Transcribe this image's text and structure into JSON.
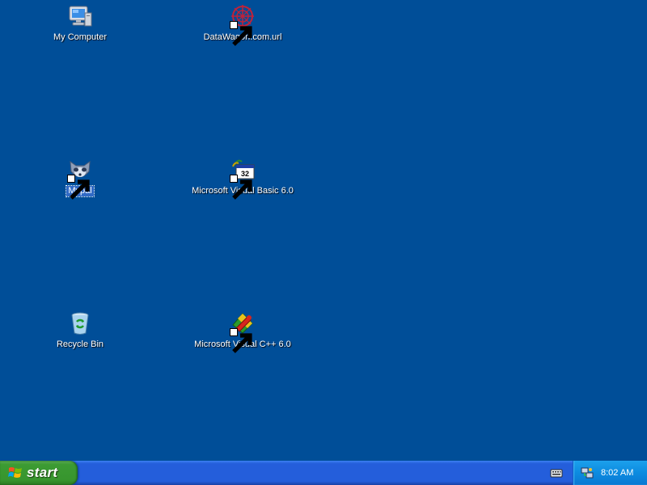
{
  "desktop": {
    "background_color": "#004e98",
    "icons": [
      {
        "label": "My Computer",
        "icon": "my-computer-icon",
        "shortcut": false,
        "selected": false
      },
      {
        "label": "DataWagon.com.url",
        "icon": "internet-shortcut-icon",
        "shortcut": true,
        "selected": false
      },
      {
        "label": "Mypal",
        "icon": "mypal-icon",
        "shortcut": true,
        "selected": true
      },
      {
        "label": "Microsoft Visual Basic 6.0",
        "icon": "visual-basic-icon",
        "shortcut": true,
        "selected": false
      },
      {
        "label": "Recycle Bin",
        "icon": "recycle-bin-icon",
        "shortcut": false,
        "selected": false
      },
      {
        "label": "Microsoft Visual C++ 6.0",
        "icon": "visual-cpp-icon",
        "shortcut": true,
        "selected": false
      }
    ]
  },
  "taskbar": {
    "start_label": "start",
    "start_icon": "windows-flag-icon",
    "tray": {
      "icons": [
        "keyboard-icon",
        "network-icon"
      ],
      "clock": "8:02 AM"
    }
  },
  "colors": {
    "taskbar": "#245edb",
    "start_button": "#3c9b33",
    "tray": "#0c8be0",
    "selection": "#316ac5"
  }
}
